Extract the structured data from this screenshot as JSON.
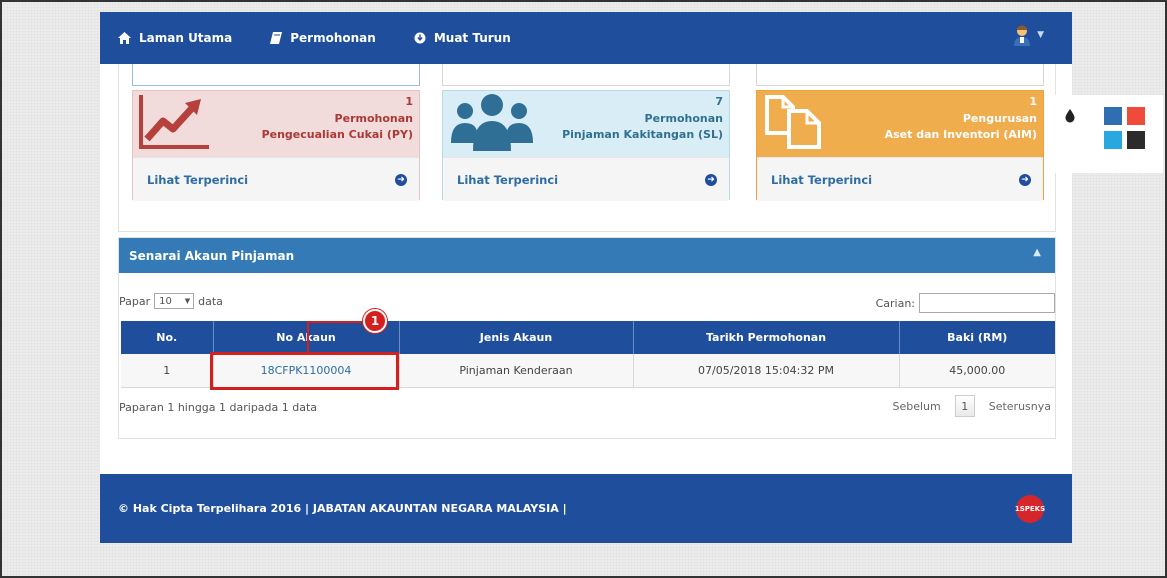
{
  "nav": {
    "items": [
      {
        "label": "Laman Utama",
        "icon": "home-icon"
      },
      {
        "label": "Permohonan",
        "icon": "book-icon"
      },
      {
        "label": "Muat Turun",
        "icon": "download-icon"
      }
    ],
    "user_icon": "user-avatar-icon"
  },
  "tiles": [
    {
      "count": "1",
      "title1": "Permohonan",
      "title2": "Pengecualian Cukai (PY)",
      "link": "Lihat Terperinci",
      "icon": "trend-chart-icon",
      "color": "#a93a37"
    },
    {
      "count": "7",
      "title1": "Permohonan",
      "title2": "Pinjaman Kakitangan (SL)",
      "link": "Lihat Terperinci",
      "icon": "users-icon",
      "color": "#31708f"
    },
    {
      "count": "1",
      "title1": "Pengurusan",
      "title2": "Aset dan Inventori (AIM)",
      "link": "Lihat Terperinci",
      "icon": "copy-icon",
      "color": "#f0ad4e"
    }
  ],
  "loan_panel": {
    "title": "Senarai Akaun Pinjaman",
    "length_prefix": "Papar",
    "length_value": "10",
    "length_suffix": "data",
    "search_label": "Carian:",
    "search_value": "",
    "columns": [
      "No.",
      "No Akaun",
      "Jenis Akaun",
      "Tarikh Permohonan",
      "Baki (RM)"
    ],
    "rows": [
      {
        "no": "1",
        "account": "18CFPK1100004",
        "type": "Pinjaman Kenderaan",
        "date": "07/05/2018 15:04:32 PM",
        "balance": "45,000.00"
      }
    ],
    "info": "Paparan 1 hingga 1 daripada 1 data",
    "prev": "Sebelum",
    "page": "1",
    "next": "Seterusnya"
  },
  "footer": {
    "text": "© Hak Cipta Terpelihara 2016 | JABATAN AKAUNTAN NEGARA MALAYSIA |",
    "logo": "1SPEKS"
  },
  "callout": {
    "number": "1",
    "color": "#d41f1f"
  },
  "theme_swatches": [
    "#2f6fb1",
    "#f04a3a",
    "#29a8e0",
    "#2b2b2b"
  ],
  "colors": {
    "primary": "#1f4f9c",
    "panel_header": "#337ab7"
  }
}
